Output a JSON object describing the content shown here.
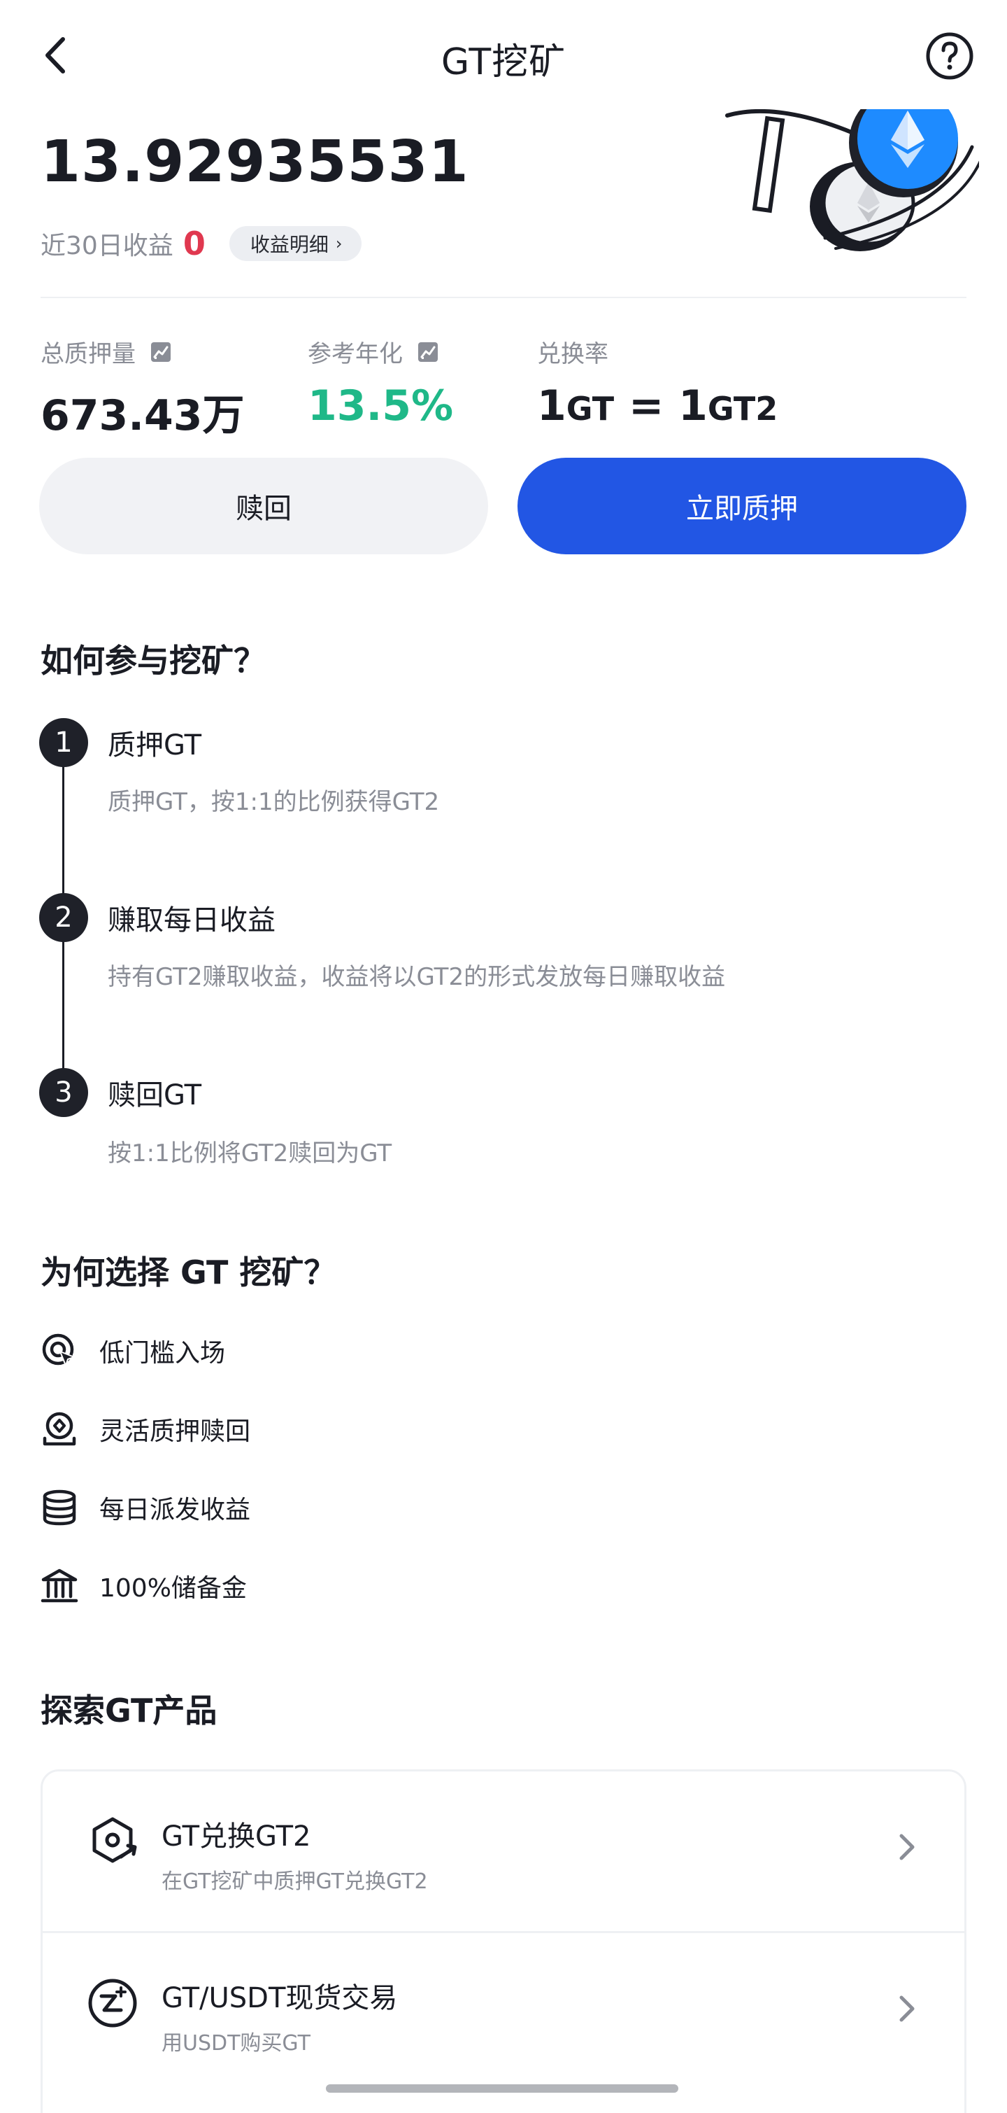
{
  "header": {
    "title": "GT挖矿"
  },
  "summary": {
    "earnings_value": "13.92935531",
    "recent_label": "近30日收益",
    "recent_value": "0",
    "detail_label": "收益明细",
    "detail_chevron": "›"
  },
  "stats": {
    "total_staked_label": "总质押量",
    "total_staked_value": "673.43万",
    "apr_label": "参考年化",
    "apr_value": "13.5%",
    "rate_label": "兑换率",
    "rate_num1": "1",
    "rate_unit1": "GT",
    "rate_eq": " = ",
    "rate_num2": "1",
    "rate_unit2": "GT2"
  },
  "actions": {
    "redeem_label": "赎回",
    "stake_label": "立即质押"
  },
  "how_to": {
    "title": "如何参与挖矿？",
    "steps": [
      {
        "num": "1",
        "title": "质押GT",
        "desc": "质押GT，按1:1的比例获得GT2"
      },
      {
        "num": "2",
        "title": "赚取每日收益",
        "desc": "持有GT2赚取收益，收益将以GT2的形式发放每日赚取收益"
      },
      {
        "num": "3",
        "title": "赎回GT",
        "desc": "按1:1比例将GT2赎回为GT"
      }
    ]
  },
  "why": {
    "title": "为何选择 GT 挖矿？",
    "items": [
      {
        "label": "低门槛入场",
        "icon": "target-cursor-icon"
      },
      {
        "label": "灵活质押赎回",
        "icon": "coin-stand-icon"
      },
      {
        "label": "每日派发收益",
        "icon": "coin-stack-icon"
      },
      {
        "label": "100%储备金",
        "icon": "bank-icon"
      }
    ]
  },
  "explore": {
    "title": "探索GT产品",
    "items": [
      {
        "title": "GT兑换GT2",
        "sub": "在GT挖矿中质押GT兑换GT2",
        "icon": "exchange-hexagon-icon"
      },
      {
        "title": "GT/USDT现货交易",
        "sub": "用USDT购买GT",
        "icon": "spot-trade-icon"
      }
    ]
  },
  "colors": {
    "accent": "#2256E4",
    "positive": "#1FB888",
    "negative": "#E0384F"
  }
}
